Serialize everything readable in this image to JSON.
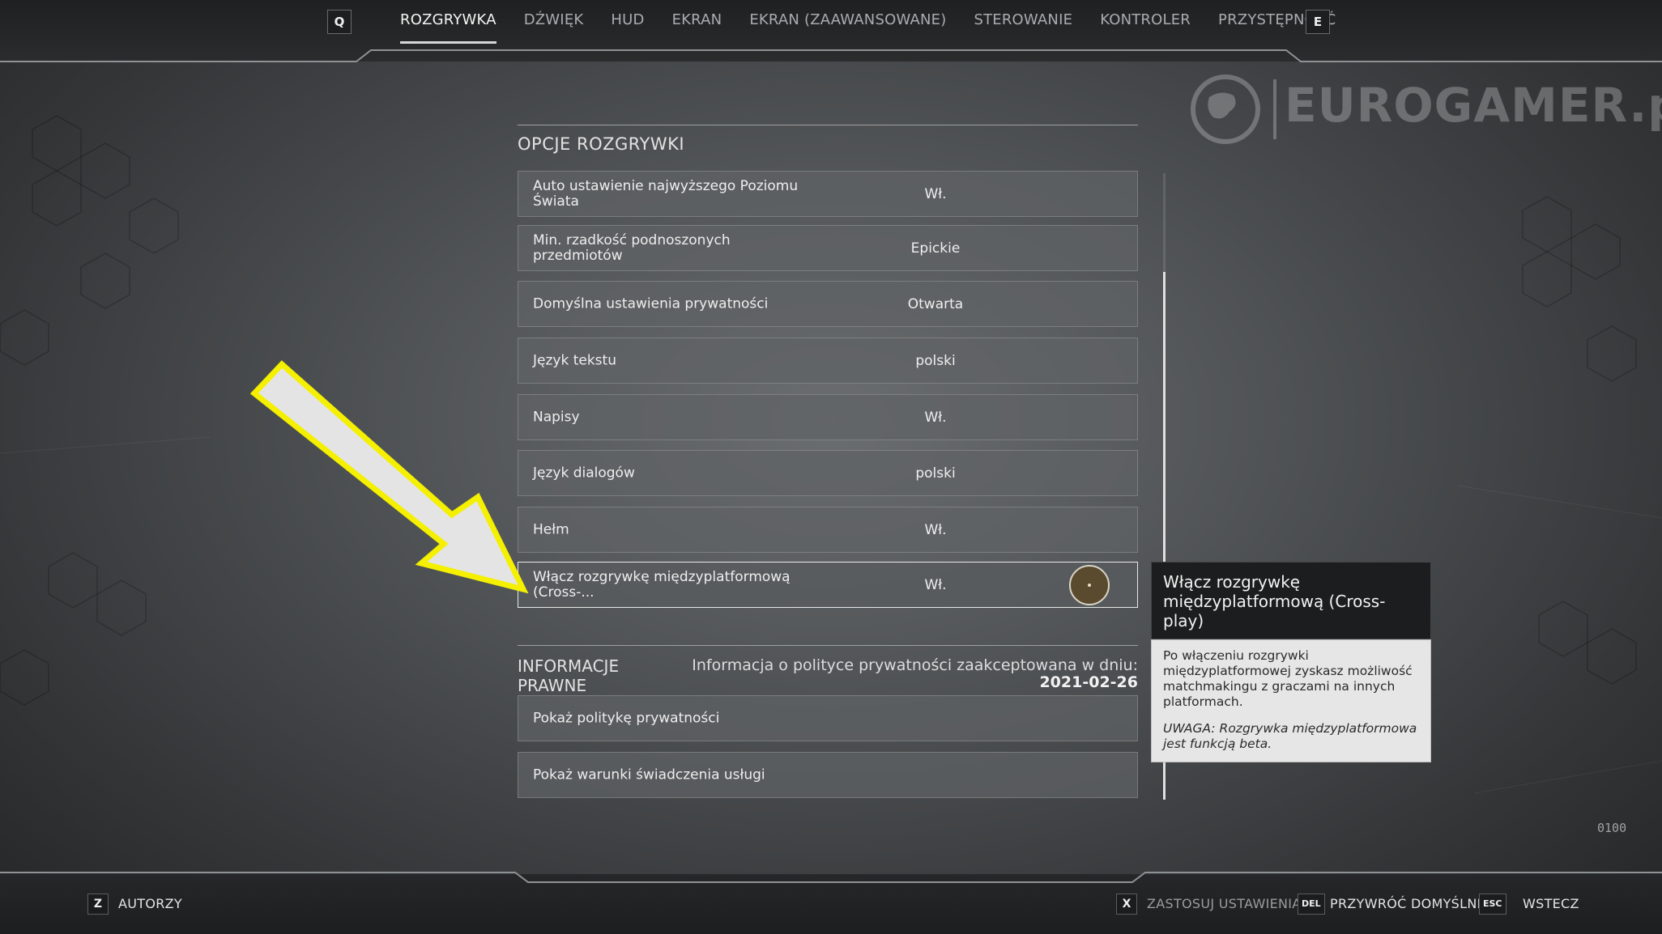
{
  "nav": {
    "prev_key": "Q",
    "next_key": "E",
    "tabs": [
      {
        "label": "ROZGRYWKA",
        "active": true
      },
      {
        "label": "DŹWIĘK"
      },
      {
        "label": "HUD"
      },
      {
        "label": "EKRAN"
      },
      {
        "label": "EKRAN (ZAAWANSOWANE)"
      },
      {
        "label": "STEROWANIE"
      },
      {
        "label": "KONTROLER"
      },
      {
        "label": "PRZYSTĘPNOŚĆ"
      }
    ]
  },
  "watermark": {
    "text": "EUROGAMER.pl"
  },
  "section": {
    "title": "OPCJE ROZGRYWKI"
  },
  "options": [
    {
      "label": "Auto ustawienie najwyższego Poziomu Świata",
      "value": "Wł."
    },
    {
      "label": "Min. rzadkość podnoszonych przedmiotów",
      "value": "Epickie"
    },
    {
      "label": "Domyślna ustawienia prywatności",
      "value": "Otwarta"
    },
    {
      "label": "Język tekstu",
      "value": "polski"
    },
    {
      "label": "Napisy",
      "value": "Wł."
    },
    {
      "label": "Język dialogów",
      "value": "polski"
    },
    {
      "label": "Hełm",
      "value": "Wł."
    },
    {
      "label": "Włącz rozgrywkę międzyplatformową (Cross-...",
      "value": "Wł."
    }
  ],
  "legal": {
    "title": "INFORMACJE PRAWNE",
    "info": "Informacja o polityce prywatności zaakceptowana w dniu:",
    "date": "2021-02-26",
    "links": [
      "Pokaż politykę prywatności",
      "Pokaż warunki świadczenia usługi"
    ]
  },
  "tooltip": {
    "title": "Włącz rozgrywkę międzyplatformową (Cross-play)",
    "body": "Po włączeniu rozgrywki międzyplatformowej zyskasz możliwość matchmakingu z graczami na innych platformach.",
    "warning": "UWAGA: Rozgrywka międzyplatformowa jest funkcją beta."
  },
  "footer": {
    "credits_key": "Z",
    "credits_label": "AUTORZY",
    "apply_key": "X",
    "apply_label": "ZASTOSUJ USTAWIENIA",
    "reset_key": "DEL",
    "reset_label": "PRZYWRÓĆ DOMYŚLNE",
    "back_key": "ESC",
    "back_label": "WSTECZ"
  },
  "corner_code": "0100",
  "colors": {
    "highlight_arrow": "#f4f000",
    "knob": "#5a4b2e"
  }
}
